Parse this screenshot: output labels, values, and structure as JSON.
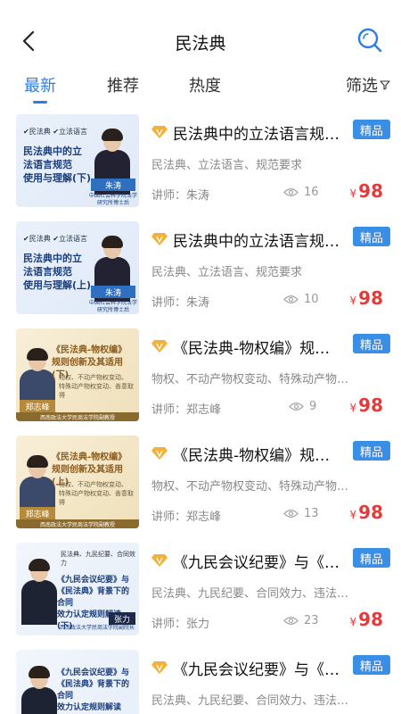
{
  "header": {
    "title": "民法典",
    "back_icon": "chevron-left-icon",
    "search_icon": "search-icon"
  },
  "tabs": [
    {
      "label": "最新",
      "active": true
    },
    {
      "label": "推荐",
      "active": false
    },
    {
      "label": "热度",
      "active": false
    }
  ],
  "filter": {
    "label": "筛选",
    "icon": "filter-icon"
  },
  "colors": {
    "accent": "#2f7de1",
    "badge": "#3a8ee6",
    "price": "#e23b3b",
    "vip": "#f0b23a"
  },
  "items": [
    {
      "title": "民法典中的立法语言规范使用与理解(下)",
      "badge": "精品",
      "keywords": "民法典、立法语言、规范要求",
      "teacher": "讲师：朱涛",
      "views": "16",
      "currency": "¥",
      "price": "98",
      "thumb": {
        "tags": "✔民法典 ✔立法语言",
        "title": "民法典中的立\n法语言规范\n使用与理解(下)",
        "name": "朱涛",
        "caption": "中国社会科学院法学\n研究所博士后"
      }
    },
    {
      "title": "民法典中的立法语言规范使用与理解(上)",
      "badge": "精品",
      "keywords": "民法典、立法语言、规范要求",
      "teacher": "讲师：朱涛",
      "views": "10",
      "currency": "¥",
      "price": "98",
      "thumb": {
        "tags": "✔民法典 ✔立法语言",
        "title": "民法典中的立\n法语言规范\n使用与理解(上)",
        "name": "朱涛",
        "caption": "中国社会科学院法学\n研究所博士后"
      }
    },
    {
      "title": "《民法典-物权编》规则创新及其适用(下)",
      "badge": "精品",
      "keywords": "物权、不动产物权变动、特殊动产物权变动",
      "teacher": "讲师：郑志峰",
      "views": "9",
      "currency": "¥",
      "price": "98",
      "thumb": {
        "title": "《民法典-物权编》\n规则创新及其适用(下)",
        "sub": "物权、不动产物权变动、\n特殊动产物权变动、善意取得",
        "name": "郑志峰",
        "footer": "西南政法大学民商法学院副教授"
      }
    },
    {
      "title": "《民法典-物权编》规则创新及其适用(上)",
      "badge": "精品",
      "keywords": "物权、不动产物权变动、特殊动产物权变动",
      "teacher": "讲师：郑志峰",
      "views": "13",
      "currency": "¥",
      "price": "98",
      "thumb": {
        "title": "《民法典-物权编》\n规则创新及其适用(上)",
        "sub": "物权、不动产物权变动、\n特殊动产物权变动、善意取得",
        "name": "郑志峰",
        "footer": "西南政法大学民商法学院副教授"
      }
    },
    {
      "title": "《九民会议纪要》与《民法典》背景下的合同效力认定规则解读(下)",
      "badge": "精品",
      "keywords": "民法典、九民纪要、合同效力、违法合同",
      "teacher": "讲师：张力",
      "views": "23",
      "currency": "¥",
      "price": "98",
      "thumb": {
        "sub": "民法典、九民纪要、合同效力",
        "title": "《九民会议纪要》与\n《民法典》背景下的合同\n效力认定规则解读(下)",
        "name": "张力",
        "caption": "西南政法大学民商法学院副院长"
      }
    },
    {
      "title": "《九民会议纪要》与《民法典》背景下的合同效力认定规则解读(上)",
      "badge": "精品",
      "keywords": "民法典、九民纪要、合同效力、违法合同",
      "teacher": "讲师：张力",
      "views": "",
      "currency": "¥",
      "price": "",
      "thumb": {
        "sub": "",
        "title": "《九民会议纪要》与\n《民法典》背景下的合同\n效力认定规则解读(上)",
        "name": "",
        "caption": ""
      }
    }
  ]
}
